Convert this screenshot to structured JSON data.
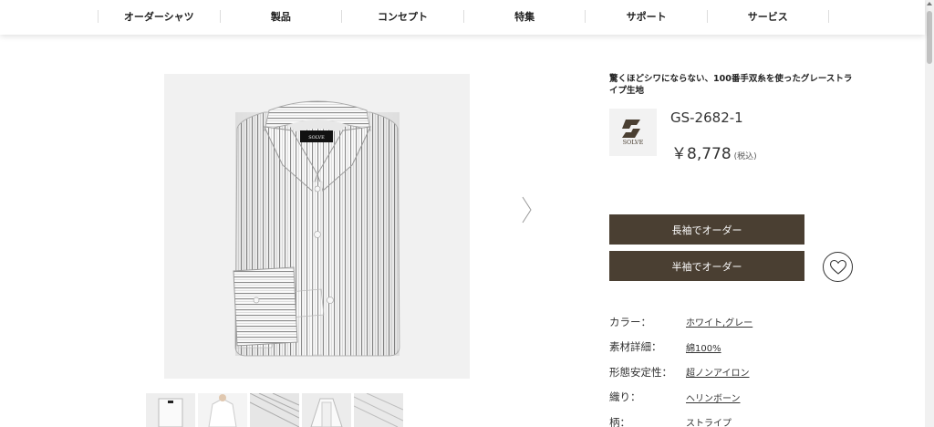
{
  "nav": {
    "items": [
      "オーダーシャツ",
      "製品",
      "コンセプト",
      "特集",
      "サポート",
      "サービス"
    ]
  },
  "product": {
    "description": "驚くほどシワにならない、100番手双糸を使ったグレーストライプ生地",
    "code": "GS-2682-1",
    "price": "￥8,778",
    "tax_note": "(税込)",
    "brand_logo_text": "SOLVE",
    "collar_tag_text": "SOLVE"
  },
  "actions": {
    "long_sleeve": "長袖でオーダー",
    "short_sleeve": "半袖でオーダー",
    "favorite_icon": "heart-icon",
    "next_icon": "chevron-right-icon"
  },
  "specs": [
    {
      "label": "カラー：",
      "value": "ホワイト,グレー"
    },
    {
      "label": "素材詳細：",
      "value": "綿100%"
    },
    {
      "label": "形態安定性：",
      "value": "超ノンアイロン"
    },
    {
      "label": "織り：",
      "value": "ヘリンボーン"
    },
    {
      "label": "柄：",
      "value": "ストライプ"
    }
  ],
  "colors": {
    "button_bg": "#4a3f32",
    "image_bg": "#f1f1f1"
  }
}
